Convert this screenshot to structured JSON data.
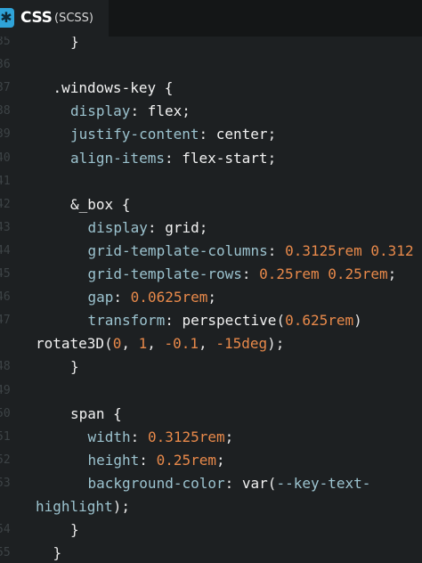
{
  "tab": {
    "icon": "css-file-icon",
    "icon_glyph": "✱",
    "title": "CSS",
    "subtitle": "(SCSS)",
    "accent": "#2fa3d8"
  },
  "editor": {
    "lines": [
      {
        "n": "35",
        "indent": 2,
        "parts": [
          [
            "}",
            "punc"
          ]
        ]
      },
      {
        "n": "36",
        "indent": 0,
        "parts": []
      },
      {
        "n": "37",
        "indent": 1,
        "parts": [
          [
            ".windows-key {",
            "sel"
          ]
        ]
      },
      {
        "n": "38",
        "indent": 2,
        "parts": [
          [
            "display",
            "prop"
          ],
          [
            ": ",
            "punc"
          ],
          [
            "flex",
            "val"
          ],
          [
            ";",
            "punc"
          ]
        ]
      },
      {
        "n": "39",
        "indent": 2,
        "parts": [
          [
            "justify-content",
            "prop"
          ],
          [
            ": ",
            "punc"
          ],
          [
            "center",
            "val"
          ],
          [
            ";",
            "punc"
          ]
        ]
      },
      {
        "n": "40",
        "indent": 2,
        "parts": [
          [
            "align-items",
            "prop"
          ],
          [
            ": ",
            "punc"
          ],
          [
            "flex-start",
            "val"
          ],
          [
            ";",
            "punc"
          ]
        ]
      },
      {
        "n": "41",
        "indent": 0,
        "parts": []
      },
      {
        "n": "42",
        "indent": 2,
        "parts": [
          [
            "&_box {",
            "sel"
          ]
        ]
      },
      {
        "n": "43",
        "indent": 3,
        "parts": [
          [
            "display",
            "prop"
          ],
          [
            ": ",
            "punc"
          ],
          [
            "grid",
            "val"
          ],
          [
            ";",
            "punc"
          ]
        ]
      },
      {
        "n": "44",
        "indent": 3,
        "parts": [
          [
            "grid-template-columns",
            "prop"
          ],
          [
            ": ",
            "punc"
          ],
          [
            "0.3125rem",
            "num"
          ],
          [
            " ",
            "punc"
          ],
          [
            "0.312",
            "num"
          ]
        ]
      },
      {
        "n": "45",
        "indent": 3,
        "parts": [
          [
            "grid-template-rows",
            "prop"
          ],
          [
            ": ",
            "punc"
          ],
          [
            "0.25rem",
            "num"
          ],
          [
            " ",
            "punc"
          ],
          [
            "0.25rem",
            "num"
          ],
          [
            ";",
            "punc"
          ]
        ]
      },
      {
        "n": "46",
        "indent": 3,
        "parts": [
          [
            "gap",
            "prop"
          ],
          [
            ": ",
            "punc"
          ],
          [
            "0.0625rem",
            "num"
          ],
          [
            ";",
            "punc"
          ]
        ]
      },
      {
        "n": "47",
        "indent": 3,
        "parts": [
          [
            "transform",
            "prop"
          ],
          [
            ": ",
            "punc"
          ],
          [
            "perspective",
            "val"
          ],
          [
            "(",
            "punc"
          ],
          [
            "0.625rem",
            "num"
          ],
          [
            ")",
            "punc"
          ]
        ]
      },
      {
        "n": "",
        "indent": 0,
        "wrap": true,
        "parts": [
          [
            "rotate3D",
            "val"
          ],
          [
            "(",
            "punc"
          ],
          [
            "0",
            "num"
          ],
          [
            ", ",
            "punc"
          ],
          [
            "1",
            "num"
          ],
          [
            ", ",
            "punc"
          ],
          [
            "-0.1",
            "num"
          ],
          [
            ", ",
            "punc"
          ],
          [
            "-15deg",
            "num"
          ],
          [
            ");",
            "punc"
          ]
        ]
      },
      {
        "n": "48",
        "indent": 2,
        "parts": [
          [
            "}",
            "punc"
          ]
        ]
      },
      {
        "n": "49",
        "indent": 0,
        "parts": []
      },
      {
        "n": "50",
        "indent": 2,
        "parts": [
          [
            "span {",
            "sel"
          ]
        ]
      },
      {
        "n": "51",
        "indent": 3,
        "parts": [
          [
            "width",
            "prop"
          ],
          [
            ": ",
            "punc"
          ],
          [
            "0.3125rem",
            "num"
          ],
          [
            ";",
            "punc"
          ]
        ]
      },
      {
        "n": "52",
        "indent": 3,
        "parts": [
          [
            "height",
            "prop"
          ],
          [
            ": ",
            "punc"
          ],
          [
            "0.25rem",
            "num"
          ],
          [
            ";",
            "punc"
          ]
        ]
      },
      {
        "n": "53",
        "indent": 3,
        "parts": [
          [
            "background-color",
            "prop"
          ],
          [
            ": ",
            "punc"
          ],
          [
            "var",
            "val"
          ],
          [
            "(",
            "punc"
          ],
          [
            "--key-text-",
            "var"
          ]
        ]
      },
      {
        "n": "",
        "indent": 0,
        "wrap": true,
        "parts": [
          [
            "highlight",
            "var"
          ],
          [
            ");",
            "punc"
          ]
        ]
      },
      {
        "n": "54",
        "indent": 2,
        "parts": [
          [
            "}",
            "punc"
          ]
        ]
      },
      {
        "n": "55",
        "indent": 1,
        "parts": [
          [
            "}",
            "punc"
          ]
        ]
      }
    ]
  }
}
